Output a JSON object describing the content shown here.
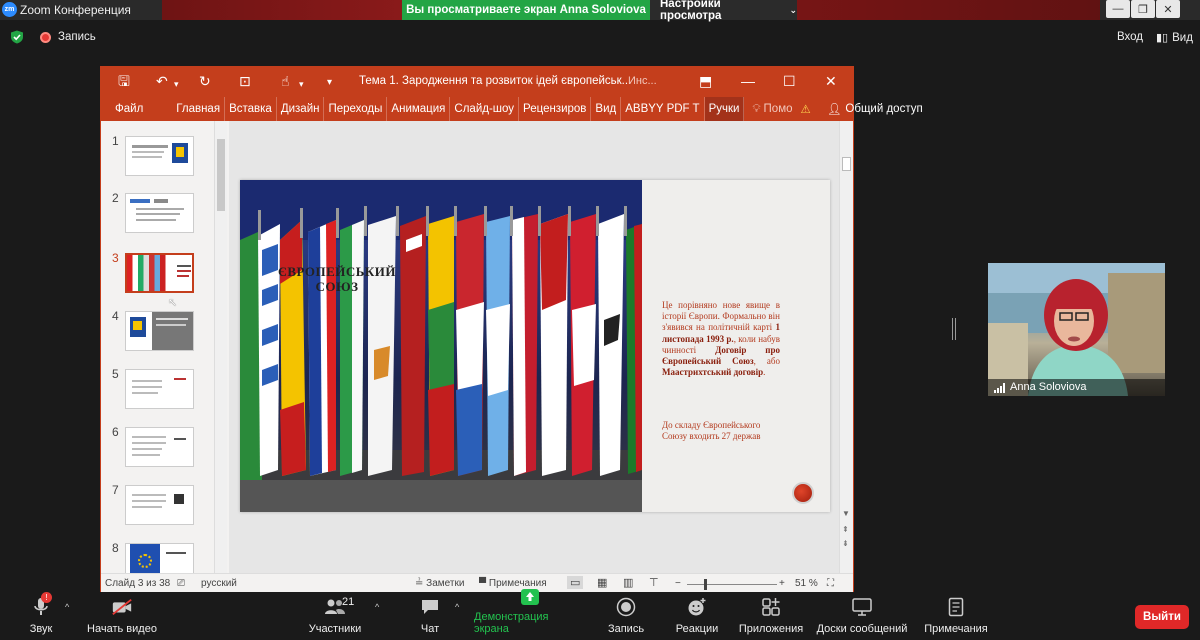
{
  "titlebar": {
    "app_title": "Zoom Конференция",
    "logo": "zm",
    "share_banner": "Вы просматриваете экран Anna Soloviova",
    "view_settings": "Настройки просмотра"
  },
  "topbar": {
    "recording_label": "Запись",
    "enter_label": "Вход",
    "view_label": "Вид"
  },
  "ppt": {
    "doc_title": "Тема 1. Зародження та розвиток ідей європейськ...",
    "doc_suffix": "Инс...",
    "ribbon_tabs": [
      "Файл",
      "Главная",
      "Вставка",
      "Дизайн",
      "Переходы",
      "Анимация",
      "Слайд-шоу",
      "Рецензиров",
      "Вид",
      "ABBYY PDF T",
      "Ручки"
    ],
    "help_label": "Помо",
    "share_label": "Общий доступ",
    "thumbnails": [
      {
        "num": "1"
      },
      {
        "num": "2"
      },
      {
        "num": "3"
      },
      {
        "num": "4"
      },
      {
        "num": "5"
      },
      {
        "num": "6"
      },
      {
        "num": "7"
      },
      {
        "num": "8"
      }
    ],
    "slide": {
      "title_line1": "ЄВРОПЕЙСЬКИЙ",
      "title_line2": "СОЮЗ",
      "body_p1": "Це порівняно нове явище в історії Європи. Формально він з'явився на політичній карті",
      "body_bold1": "1 листопада 1993 р.",
      "body_p2": ", коли набув чинності",
      "body_bold2": "Договір про Європейський Союз",
      "body_p3": ", або",
      "body_bold3": "Маастрихтський договір",
      "body_p4": ".",
      "body2": "До складу Європейського Союзу входить 27 держав"
    },
    "status": {
      "slide_counter": "Слайд 3 из 38",
      "language": "русский",
      "notes": "Заметки",
      "comments": "Примечания",
      "zoom": "51 %"
    }
  },
  "video": {
    "participant_name": "Anna Soloviova"
  },
  "toolbar": {
    "audio": "Звук",
    "video": "Начать видео",
    "participants": "Участники",
    "participants_count": "21",
    "chat": "Чат",
    "share": "Демонстрация экрана",
    "record": "Запись",
    "reactions": "Реакции",
    "apps": "Приложения",
    "whiteboards": "Доски сообщений",
    "notes": "Примечания",
    "exit": "Выйти",
    "audio_badge": "!"
  },
  "colors": {
    "ppt_accent": "#c43e1c",
    "share_green": "#23a545",
    "exit_red": "#e02828",
    "zoom_blue": "#2d8cff"
  }
}
